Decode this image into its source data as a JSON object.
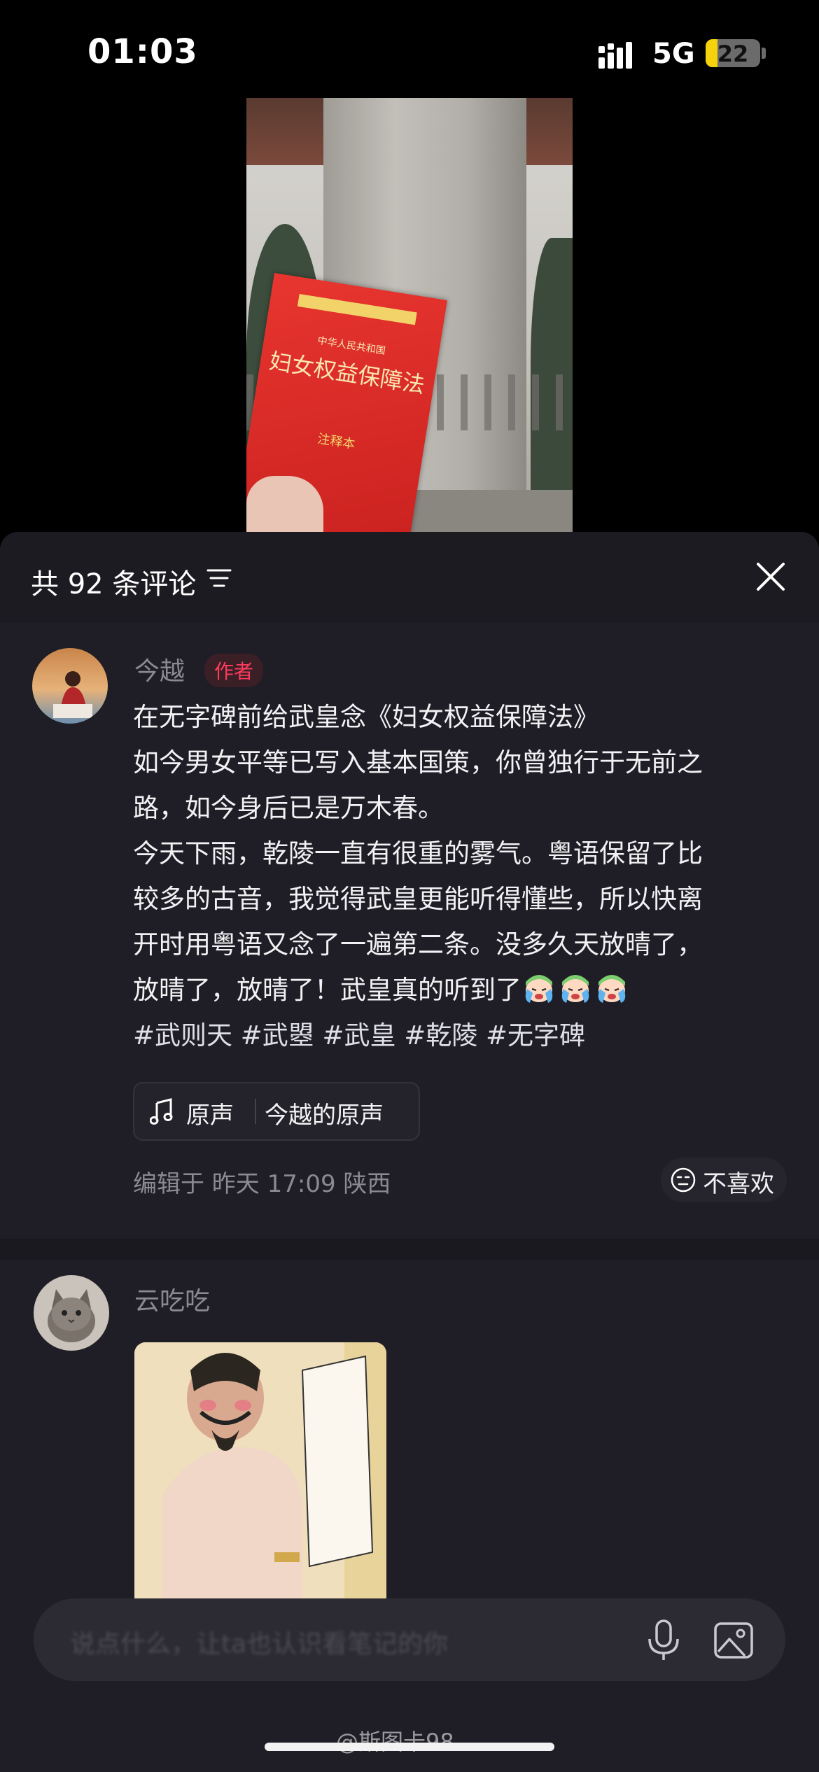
{
  "status_bar": {
    "time": "01:03",
    "network": "5G",
    "battery": "22",
    "battery_level_percent": 22
  },
  "video": {
    "book_subtitle": "中华人民共和国",
    "book_title": "妇女权益保障法",
    "book_footer": "注释本"
  },
  "comments_panel": {
    "count_label": "共 92 条评论",
    "comments": [
      {
        "name": "今越",
        "badge": "作者",
        "lines": [
          "在无字碑前给武皇念《妇女权益保障法》",
          "如今男女平等已写入基本国策，你曾独行于无前之",
          "路，如今身后已是万木春。",
          "今天下雨，乾陵一直有很重的雾气。粤语保留了比",
          "较多的古音，我觉得武皇更能听得懂些，所以快离",
          "开时用粤语又念了一遍第二条。没多久天放晴了，",
          "放晴了，放晴了！武皇真的听到了"
        ],
        "emoji_name": "crying-face",
        "emoji_count": 3,
        "hashtags": "#武则天 #武曌 #武皇 #乾陵 #无字碑",
        "music_label": "原声",
        "music_source": "今越的原声",
        "meta": "编辑于  昨天 17:09  陕西",
        "dislike_label": "不喜欢"
      },
      {
        "name": "云吃吃"
      }
    ]
  },
  "input_bar": {
    "placeholder": "说点什么，让ta也认识看笔记的你"
  },
  "watermark": "@斯图卡98"
}
